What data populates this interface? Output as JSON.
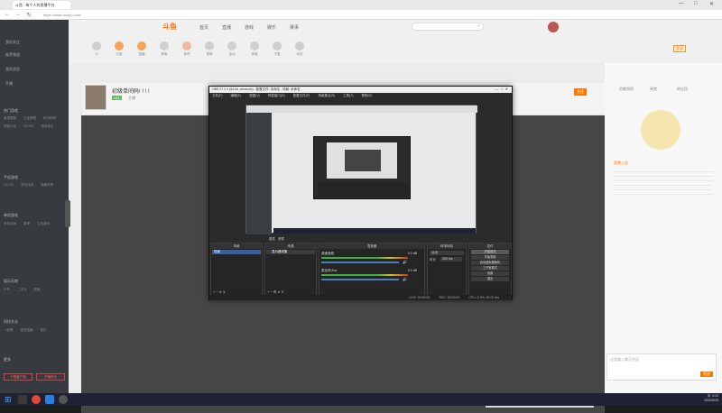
{
  "browser": {
    "tab_title": "斗鱼 - 每个人的直播平台",
    "url": "https://www.douyu.com/",
    "window_controls": [
      "—",
      "□",
      "✕"
    ]
  },
  "topnav": {
    "logo": "斗鱼",
    "links": [
      "首页",
      "直播",
      "游戏",
      "娱乐",
      "赛事"
    ],
    "icons": [
      "12",
      "分类",
      "直播",
      "赛事",
      "鱼吧",
      "视频",
      "活动",
      "商城",
      "下载",
      "动态"
    ],
    "login": "登录"
  },
  "sidebar": {
    "items": [
      "我的关注",
      "推荐频道",
      "我的消息",
      "开播"
    ],
    "sections": [
      "热门游戏",
      "手机游戏",
      "单机游戏",
      "娱乐天地",
      "科技文化",
      "更多"
    ],
    "game_rows": [
      [
        "英雄联盟",
        "王者荣耀",
        "和平精英"
      ],
      [
        "穿越火线",
        "DOTA2",
        "绝地求生"
      ],
      [
        "CS:GO",
        "炉石传说",
        "魔兽世界"
      ],
      [
        "永劫无间",
        "原神",
        "主机游戏"
      ],
      [
        "户外",
        "二次元",
        "颜值"
      ],
      [
        "一起看",
        "语音直播",
        "音乐"
      ]
    ],
    "promo_buttons": [
      "下载客户端",
      "开播助手"
    ]
  },
  "room": {
    "title": "初级单间码! ! ! !",
    "streamer": "主播",
    "follow_label": "关注",
    "level": "LV1"
  },
  "obs": {
    "title": "OBS 27.2.4 (64-bit, windows) - 配置文件: 未命名 - 场景: 未命名",
    "menu": [
      "文件(F)",
      "编辑(E)",
      "视图(V)",
      "停靠窗口(D)",
      "配置文件(P)",
      "场景集合(S)",
      "工具(T)",
      "帮助(H)"
    ],
    "docks": {
      "scenes": "场景",
      "sources": "来源",
      "mixer": "混音器",
      "transitions": "转场特效",
      "controls": "控件"
    },
    "scene_item": "场景",
    "source_item": "显示器采集",
    "source_props": "属性",
    "source_filters": "滤镜",
    "mixer_tracks": [
      {
        "name": "桌面音频",
        "db": "0.0 dB"
      },
      {
        "name": "麦克风/Aux",
        "db": "0.0 dB"
      }
    ],
    "transition_type": "淡出",
    "duration_label": "时长",
    "duration_value": "300 ms",
    "control_buttons": [
      "开始推流",
      "开始录制",
      "启动虚拟摄像机",
      "工作室模式",
      "设置",
      "退出"
    ],
    "status": {
      "live": "LIVE: 00:00:00",
      "rec": "REC: 00:00:00",
      "cpu": "CPU: 3.4%, 60.00 fps"
    }
  },
  "right_panel": {
    "tabs": [
      "贡献周榜",
      "贵宾",
      "粉丝团"
    ],
    "notice_title": "直播公告",
    "chat_placeholder": "这里输入聊天内容",
    "send_label": "发送"
  },
  "notification": "正在共享你的屏幕 - 停止共享",
  "taskbar": {
    "time": "9:23",
    "date": "2022/6/29",
    "lang": "中"
  },
  "colors": {
    "brand_orange": "#ff7700",
    "sidebar_bg": "#373b40",
    "obs_bg": "#2b2b2b",
    "video_bg": "#464646",
    "taskbar_bg": "#1f2233"
  }
}
